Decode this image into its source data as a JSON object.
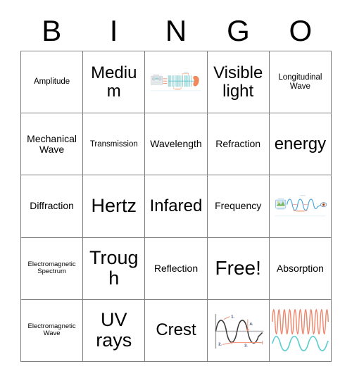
{
  "card": {
    "header_letters": [
      "B",
      "I",
      "N",
      "G",
      "O"
    ],
    "rows": [
      [
        {
          "type": "text",
          "label": "Amplitude",
          "size": "sm"
        },
        {
          "type": "text",
          "label": "Medium",
          "size": "xl"
        },
        {
          "type": "image",
          "label": "sound-wave-boombox-to-ear-diagram"
        },
        {
          "type": "text",
          "label": "Visible light",
          "size": "xl"
        },
        {
          "type": "text",
          "label": "Longitudinal Wave",
          "size": "sm"
        }
      ],
      [
        {
          "type": "text",
          "label": "Mechanical Wave",
          "size": "md"
        },
        {
          "type": "text",
          "label": "Transmission",
          "size": "sm"
        },
        {
          "type": "text",
          "label": "Wavelength",
          "size": "md"
        },
        {
          "type": "text",
          "label": "Refraction",
          "size": "md"
        },
        {
          "type": "text",
          "label": "energy",
          "size": "xl"
        }
      ],
      [
        {
          "type": "text",
          "label": "Diffraction",
          "size": "md"
        },
        {
          "type": "text",
          "label": "Hertz",
          "size": "xxl"
        },
        {
          "type": "text",
          "label": "Infared",
          "size": "xl"
        },
        {
          "type": "text",
          "label": "Frequency",
          "size": "md"
        },
        {
          "type": "image",
          "label": "light-wave-screen-to-eye-diagram"
        }
      ],
      [
        {
          "type": "text",
          "label": "Electromagnetic Spectrum",
          "size": "xs"
        },
        {
          "type": "text",
          "label": "Trough",
          "size": "xxl"
        },
        {
          "type": "text",
          "label": "Reflection",
          "size": "md"
        },
        {
          "type": "text",
          "label": "Free!",
          "size": "free"
        },
        {
          "type": "text",
          "label": "Absorption",
          "size": "md"
        }
      ],
      [
        {
          "type": "text",
          "label": "Electromagnetic Wave",
          "size": "xs"
        },
        {
          "type": "text",
          "label": "UV rays",
          "size": "xxl"
        },
        {
          "type": "text",
          "label": "Crest",
          "size": "xl"
        },
        {
          "type": "image",
          "label": "labeled-wave-parts-diagram"
        },
        {
          "type": "image",
          "label": "high-vs-low-frequency-wave-diagram"
        }
      ]
    ],
    "colors": {
      "grid_line": "#808080",
      "text": "#000000",
      "background": "#ffffff",
      "wave_teal": "#5bbfc4",
      "wave_orange": "#e8734a",
      "wave_salmon": "#ef8b72",
      "wave_blue": "#4a9fd4",
      "wave_cyan": "#62cfcf",
      "wave_dark": "#3a3a3a"
    },
    "diagrams": {
      "sound_wave": {
        "source": "boombox",
        "receiver": "ear",
        "wave_style": "longitudinal-compression"
      },
      "light_wave": {
        "source": "screen",
        "receiver": "eye",
        "wave_style": "transverse"
      },
      "labeled_wave": {
        "annotations": [
          "1.",
          "2.",
          "3.",
          "4."
        ]
      },
      "frequency_compare": {
        "top": "high frequency",
        "bottom": "low frequency"
      }
    }
  }
}
